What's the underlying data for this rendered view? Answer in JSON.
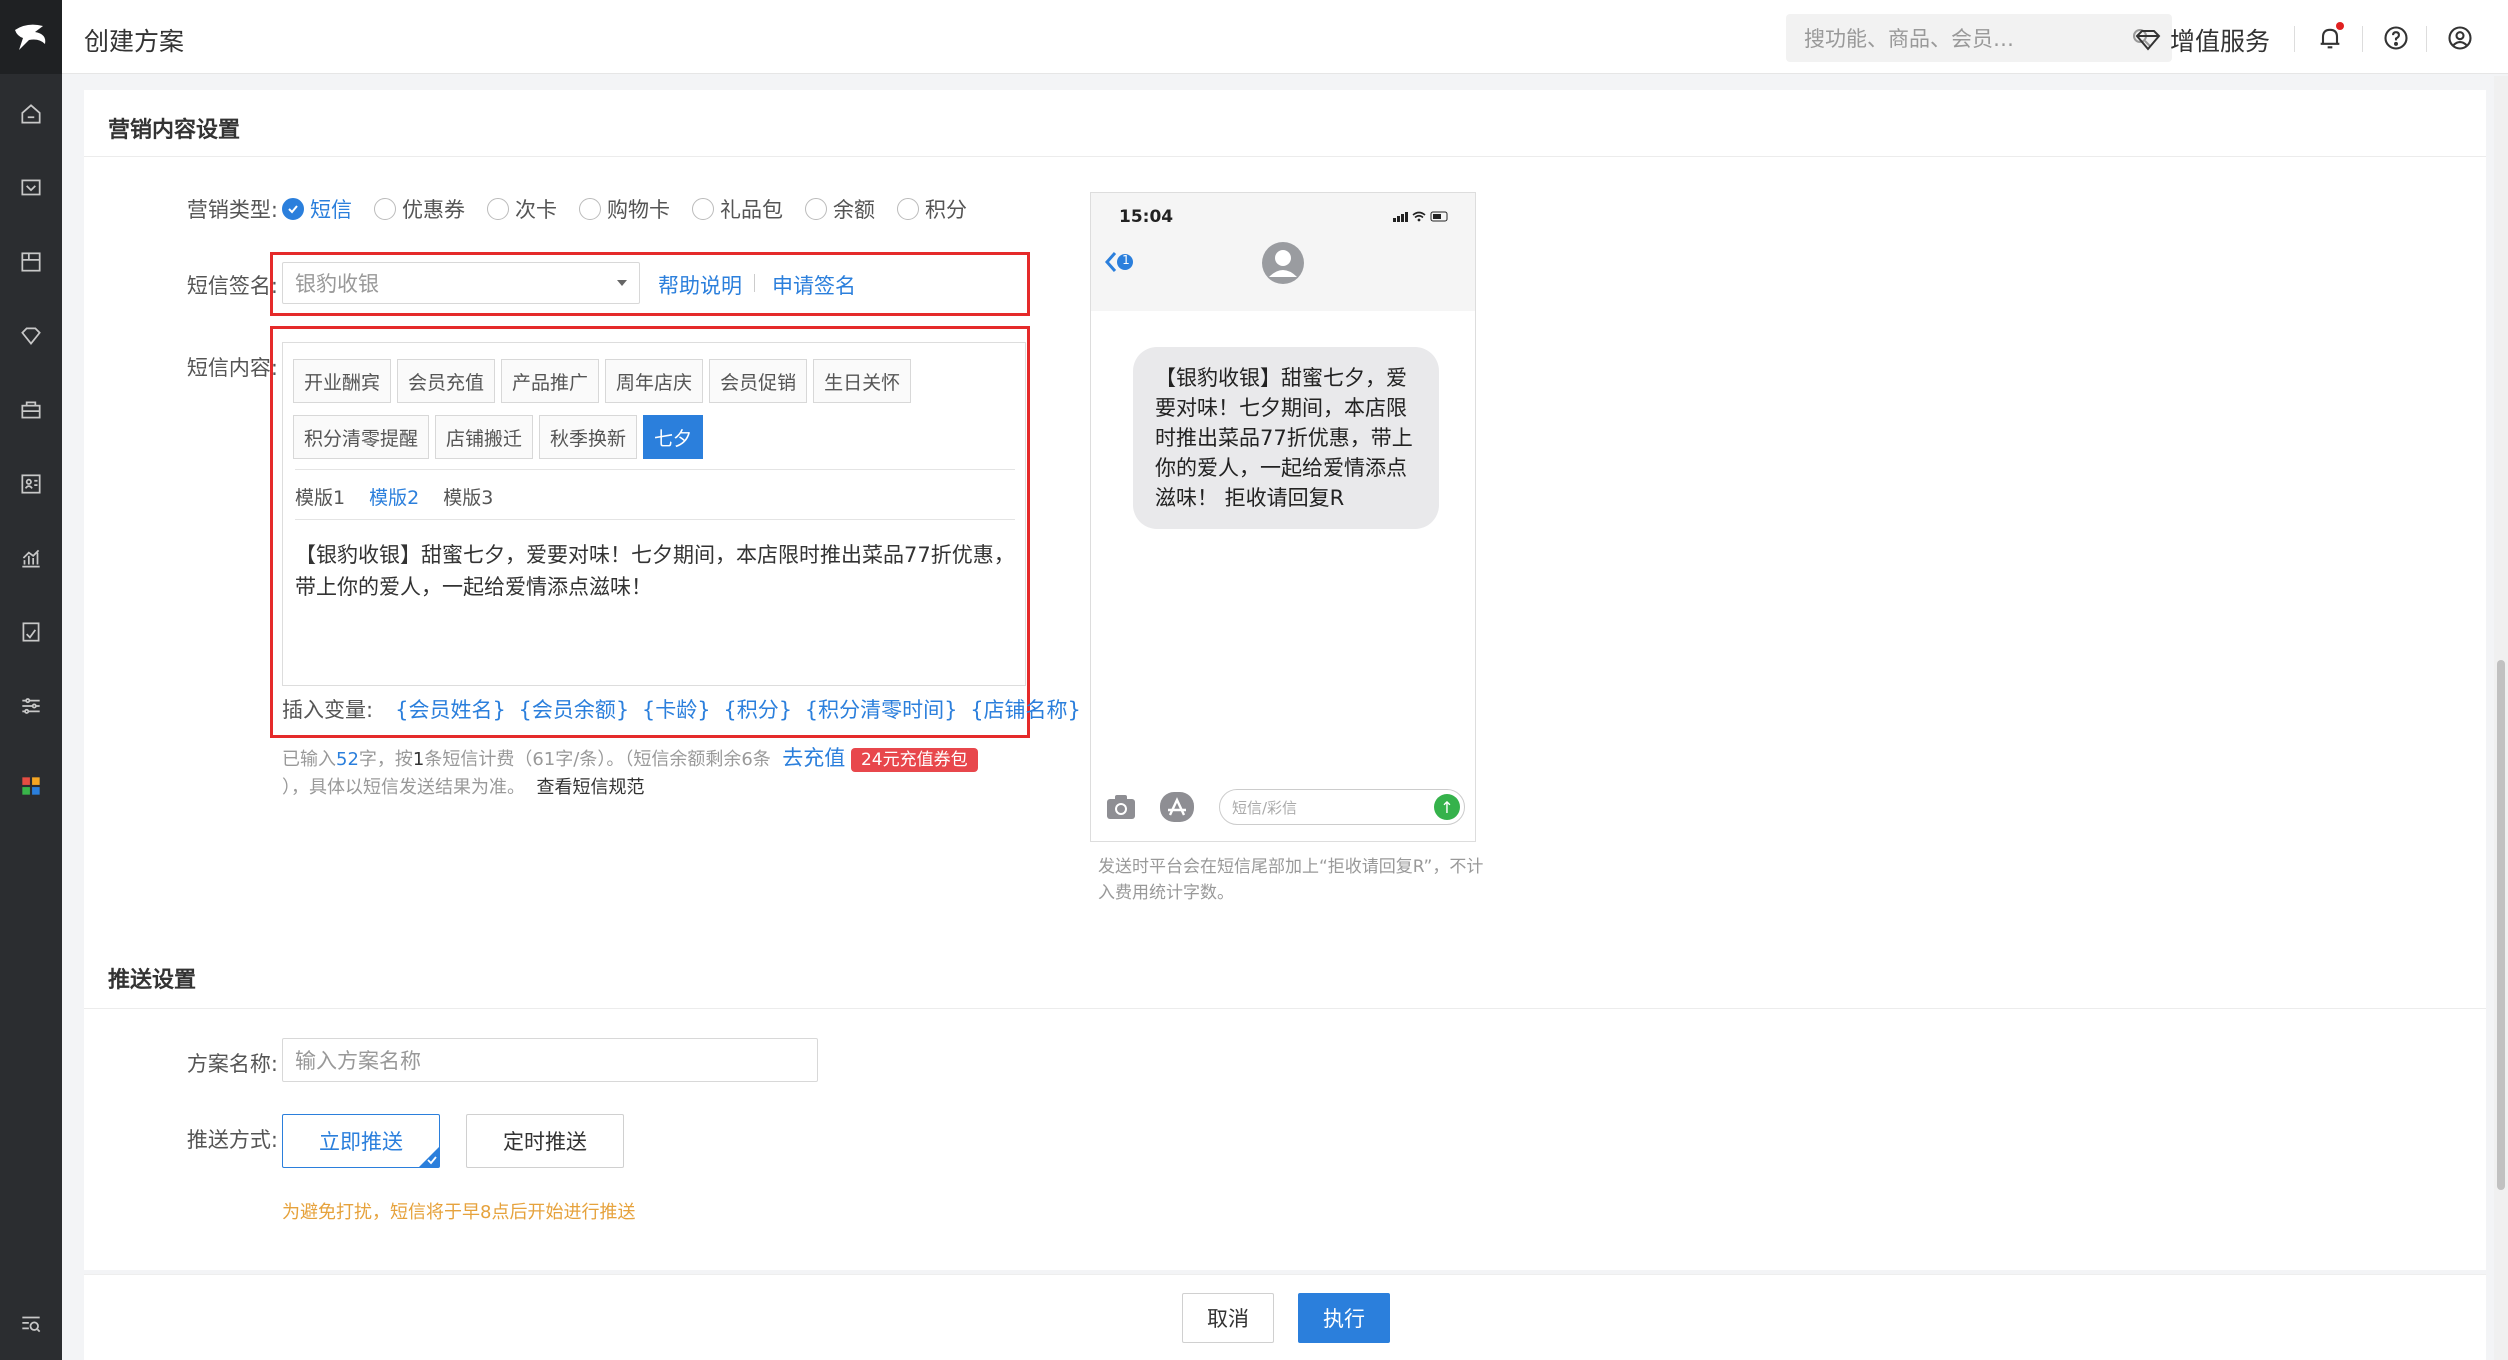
{
  "header": {
    "page_title": "创建方案",
    "search_placeholder": "搜功能、商品、会员…",
    "vip_label": "增值服务"
  },
  "marketing": {
    "section_title": "营销内容设置",
    "type_label": "营销类型:",
    "types": [
      "短信",
      "优惠券",
      "次卡",
      "购物卡",
      "礼品包",
      "余额",
      "积分"
    ],
    "selected_type": "短信",
    "signature_label": "短信签名:",
    "signature_value": "银豹收银",
    "help_link": "帮助说明",
    "apply_link": "申请签名",
    "content_label": "短信内容:",
    "tags": [
      "开业酬宾",
      "会员充值",
      "产品推广",
      "周年店庆",
      "会员促销",
      "生日关怀",
      "积分清零提醒",
      "店铺搬迁",
      "秋季换新",
      "七夕"
    ],
    "selected_tag": "七夕",
    "templates": [
      "模版1",
      "模版2",
      "模版3"
    ],
    "selected_template": "模版2",
    "sms_text": "【银豹收银】甜蜜七夕，爱要对味！七夕期间，本店限时推出菜品77折优惠，带上你的爱人，一起给爱情添点滋味！",
    "insert_var_label": "插入变量:",
    "variables": [
      "{会员姓名}",
      "{会员余额}",
      "{卡龄}",
      "{积分}",
      "{积分清零时间}",
      "{店铺名称}"
    ],
    "count": {
      "prefix": "已输入",
      "chars": "52",
      "mid1": "字，按",
      "msgs": "1",
      "mid2": "条短信计费（61字/条）。（短信余额剩余6条",
      "recharge_link": "去充值",
      "badge": "24元充值券包",
      "suffix": "），具体以短信发送结果为准。",
      "rules_link": "查看短信规范"
    }
  },
  "phone": {
    "time": "15:04",
    "back_count": "1",
    "bubble": "【银豹收银】甜蜜七夕，爱要对味！七夕期间，本店限时推出菜品77折优惠，带上你的爱人，一起给爱情添点滋味！ 拒收请回复R",
    "input_placeholder": "短信/彩信",
    "note": "发送时平台会在短信尾部加上“拒收请回复R”，不计入费用统计字数。"
  },
  "push": {
    "section_title": "推送设置",
    "name_label": "方案名称:",
    "name_placeholder": "输入方案名称",
    "method_label": "推送方式:",
    "method_now": "立即推送",
    "method_timed": "定时推送",
    "warning": "为避免打扰，短信将于早8点后开始进行推送"
  },
  "footer": {
    "cancel": "取消",
    "execute": "执行"
  },
  "colors": {
    "accent": "#2b7fdc",
    "highlight_border": "#e52a2a",
    "warning": "#e6a23c",
    "sidebar": "#2b2d30"
  }
}
